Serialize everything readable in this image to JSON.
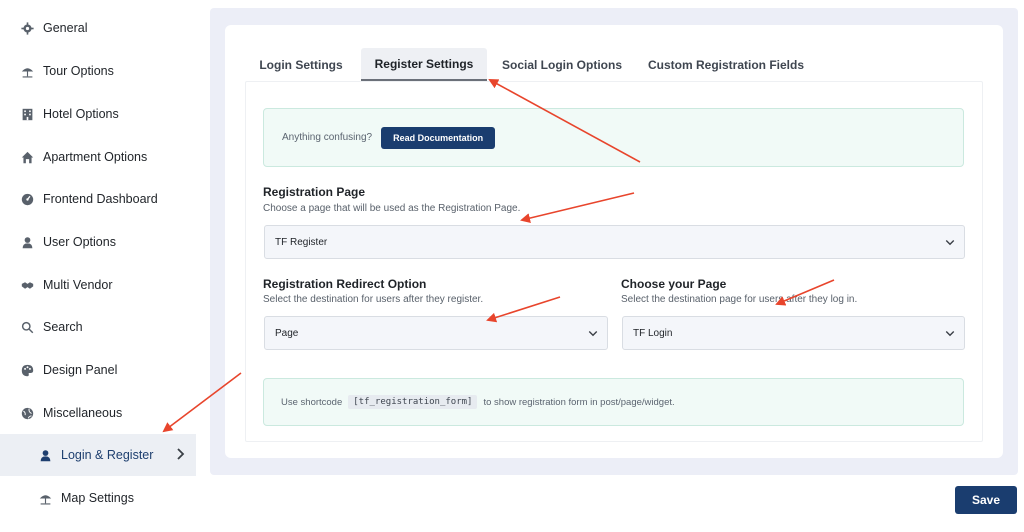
{
  "sidebar": {
    "items": [
      {
        "label": "General",
        "icon": "gear-icon"
      },
      {
        "label": "Tour Options",
        "icon": "umbrella-icon"
      },
      {
        "label": "Hotel Options",
        "icon": "building-icon"
      },
      {
        "label": "Apartment Options",
        "icon": "home-icon"
      },
      {
        "label": "Frontend Dashboard",
        "icon": "dashboard-icon"
      },
      {
        "label": "User Options",
        "icon": "user-icon"
      },
      {
        "label": "Multi Vendor",
        "icon": "handshake-icon"
      },
      {
        "label": "Search",
        "icon": "search-icon"
      },
      {
        "label": "Design Panel",
        "icon": "palette-icon"
      },
      {
        "label": "Miscellaneous",
        "icon": "globe-icon"
      },
      {
        "label": "Login & Register",
        "icon": "user-icon",
        "active": true
      },
      {
        "label": "Map Settings",
        "icon": "umbrella-icon"
      }
    ]
  },
  "tabs": [
    {
      "label": "Login Settings"
    },
    {
      "label": "Register Settings",
      "active": true
    },
    {
      "label": "Social Login Options"
    },
    {
      "label": "Custom Registration Fields"
    }
  ],
  "notice": {
    "text": "Anything confusing?",
    "button_label": "Read Documentation"
  },
  "registration_page": {
    "label": "Registration Page",
    "description": "Choose a page that will be used as the Registration Page.",
    "value": "TF Register"
  },
  "redirect_option": {
    "label": "Registration Redirect Option",
    "description": "Select the destination for users after they register.",
    "value": "Page"
  },
  "choose_page": {
    "label": "Choose your Page",
    "description": "Select the destination page for users after they log in.",
    "value": "TF Login"
  },
  "shortcode_notice": {
    "prefix": "Use shortcode",
    "code": "[tf_registration_form]",
    "suffix": "to show registration form in post/page/widget."
  },
  "save_label": "Save",
  "colors": {
    "primary": "#1a3d6f",
    "panel_bg": "#eceef7",
    "notice_bg": "#f1faf7",
    "arrow": "#e8452c"
  }
}
